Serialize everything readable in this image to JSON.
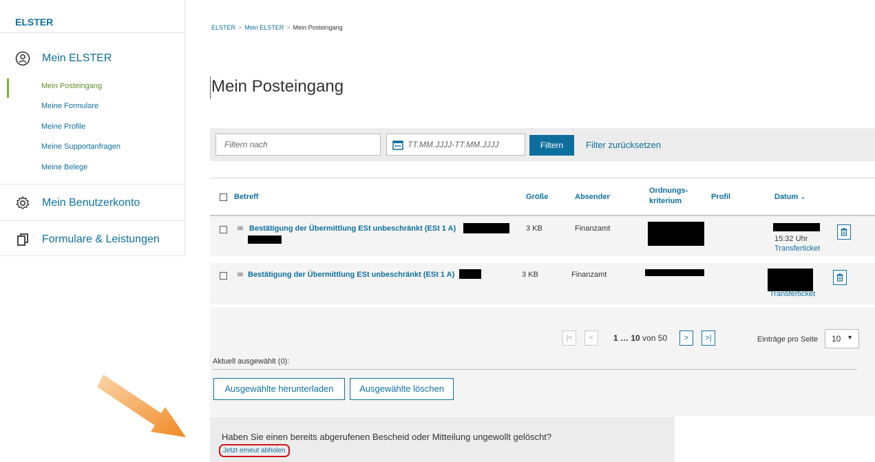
{
  "sidebar": {
    "brand": "ELSTER",
    "sections": [
      {
        "label": "Mein ELSTER",
        "icon": "user-circle-icon"
      },
      {
        "label": "Mein Benutzerkonto",
        "icon": "gear-icon"
      },
      {
        "label": "Formulare & Leistungen",
        "icon": "documents-icon"
      }
    ],
    "items": [
      {
        "label": "Mein Posteingang",
        "active": true
      },
      {
        "label": "Meine Formulare"
      },
      {
        "label": "Meine Profile"
      },
      {
        "label": "Meine Supportanfragen"
      },
      {
        "label": "Meine Belege"
      }
    ]
  },
  "breadcrumb": [
    "ELSTER",
    "Mein ELSTER",
    "Mein Posteingang"
  ],
  "page_title": "Mein Posteingang",
  "filter": {
    "placeholder": "Filtern nach",
    "date_placeholder": "TT.MM.JJJJ-TT.MM.JJJJ",
    "button": "Filtern",
    "reset": "Filter zurücksetzen"
  },
  "table": {
    "headers": {
      "subject": "Betreff",
      "size": "Größe",
      "sender": "Absender",
      "criterion_1": "Ordnungs-",
      "criterion_2": "kriterium",
      "profile": "Profil",
      "date": "Datum"
    },
    "rows": [
      {
        "subject": "Bestätigung der Übermittlung ESt unbeschränkt (ESt 1 A)",
        "size": "3 KB",
        "sender": "Finanzamt",
        "time": "15:32 Uhr",
        "link": "Transferticket"
      },
      {
        "subject": "Bestätigung der Übermittlung ESt unbeschränkt (ESt 1 A)",
        "size": "3 KB",
        "sender": "Finanzamt",
        "time": "",
        "link": "Transferticket"
      }
    ]
  },
  "pagination": {
    "range": "1 … 10",
    "of_text": "von 50",
    "per_page_label": "Einträge pro Seite",
    "per_page_value": "10"
  },
  "selection": {
    "label": "Aktuell ausgewählt (0):",
    "download": "Ausgewählte herunterladen",
    "delete": "Ausgewählte löschen"
  },
  "info": {
    "question": "Haben Sie einen bereits abgerufenen Bescheid oder Mitteilung ungewollt gelöscht?",
    "link": "Jetzt erneut abholen"
  },
  "colors": {
    "accent": "#0e6f9e",
    "active_green": "#7bad2c",
    "highlight_red": "#d0141b",
    "arrow": "#f08a24"
  }
}
